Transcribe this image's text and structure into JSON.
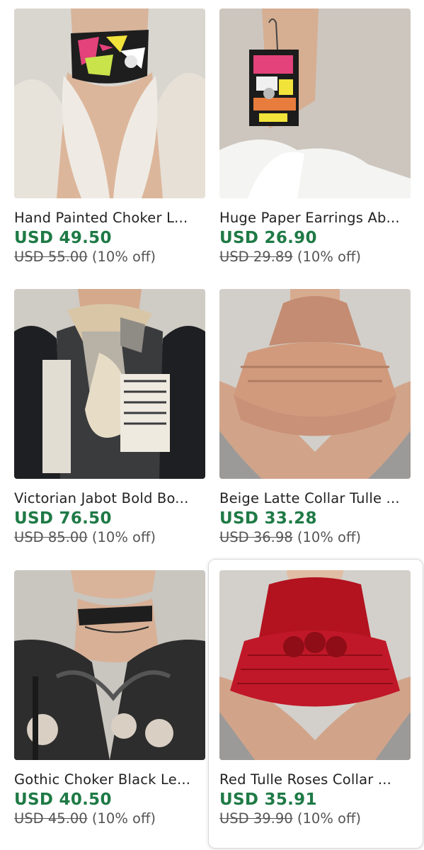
{
  "listings": [
    {
      "title": "Hand Painted Choker L...",
      "price": "USD 49.50",
      "original_price": "USD 55.00",
      "discount": "(10% off)"
    },
    {
      "title": "Huge Paper Earrings Ab...",
      "price": "USD 26.90",
      "original_price": "USD 29.89",
      "discount": "(10% off)"
    },
    {
      "title": "Victorian Jabot Bold Bo...",
      "price": "USD 76.50",
      "original_price": "USD 85.00",
      "discount": "(10% off)"
    },
    {
      "title": "Beige Latte Collar Tulle ...",
      "price": "USD 33.28",
      "original_price": "USD 36.98",
      "discount": "(10% off)"
    },
    {
      "title": "Gothic Choker Black Le...",
      "price": "USD 40.50",
      "original_price": "USD 45.00",
      "discount": "(10% off)"
    },
    {
      "title": "Red Tulle Roses Collar ...",
      "price": "USD 35.91",
      "original_price": "USD 39.90",
      "discount": "(10% off)"
    }
  ],
  "colors": {
    "price_green": "#1f7a46",
    "title_text": "#222222",
    "muted_text": "#555555"
  }
}
